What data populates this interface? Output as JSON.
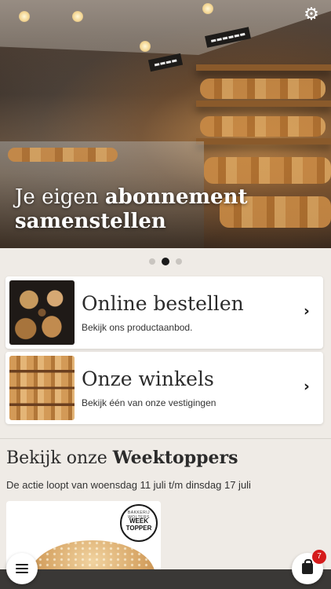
{
  "hero": {
    "caption_regular": "Je eigen",
    "caption_bold": "abonnement",
    "caption_line2": "samenstellen",
    "settings_icon": "⚙"
  },
  "carousel": {
    "slide_count": 3,
    "active_index": 1
  },
  "cards": [
    {
      "title": "Online bestellen",
      "subtitle": "Bekijk ons productaanbod.",
      "chevron": "›"
    },
    {
      "title": "Onze winkels",
      "subtitle": "Bekijk één van onze vestigingen",
      "chevron": "›"
    }
  ],
  "weektoppers": {
    "title_regular": "Bekijk onze",
    "title_bold": "Weektoppers",
    "subtitle": "De actie loopt van woensdag 11 juli t/m dinsdag 17 juli",
    "badge_top": "BAKKERIJ WOLTERS",
    "badge_main_1": "WEEK",
    "badge_main_2": "TOPPER"
  },
  "cart": {
    "count": "7"
  },
  "colors": {
    "background": "#efebe6",
    "badge_red": "#d51b1b",
    "bottom_bar": "#3a3836"
  }
}
